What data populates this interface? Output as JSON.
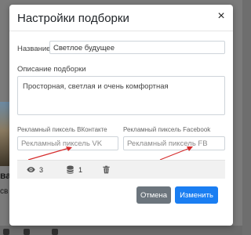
{
  "background": {
    "title_fragment": "ва",
    "subtitle_fragment": "св"
  },
  "modal": {
    "title": "Настройки подборки",
    "name": {
      "label": "Название",
      "value": "Светлое будущее"
    },
    "description": {
      "label": "Описание подборки",
      "value": "Просторная, светлая и очень комфортная"
    },
    "vk_pixel": {
      "label": "Рекламный пиксель ВКонтакте",
      "placeholder": "Рекламный пиксель VK"
    },
    "fb_pixel": {
      "label": "Рекламный пиксель Facebook",
      "placeholder": "Рекламный пиксель FB"
    },
    "stats": {
      "views": "3",
      "items": "1"
    },
    "buttons": {
      "cancel": "Отмена",
      "save": "Изменить"
    }
  },
  "colors": {
    "primary": "#1a7ef2",
    "secondary": "#6c757d",
    "annotation_arrow": "#d62d2d"
  },
  "icons": [
    "close-icon",
    "eye-icon",
    "database-icon",
    "trash-icon"
  ]
}
